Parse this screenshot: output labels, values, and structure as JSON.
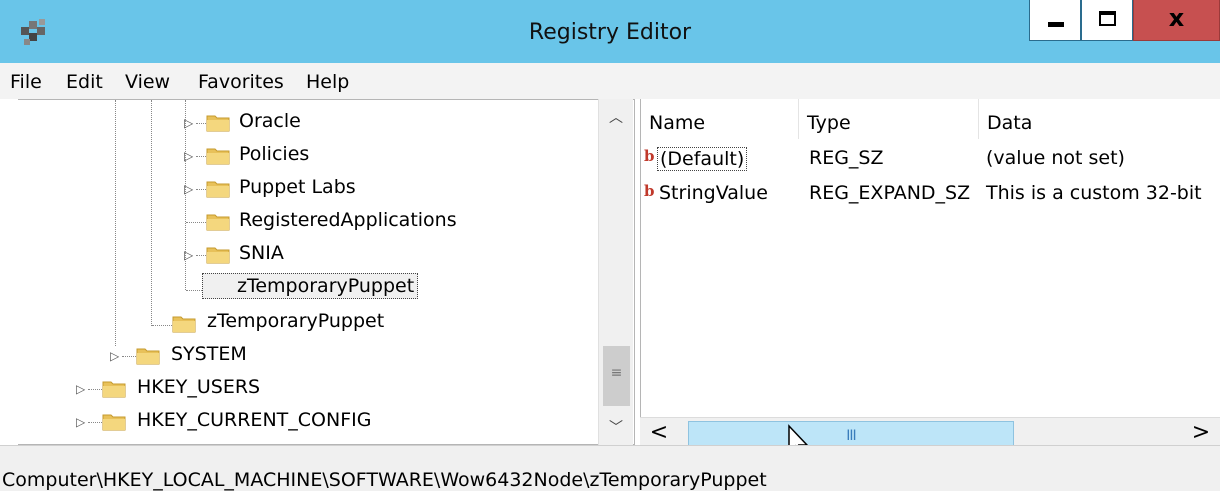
{
  "window": {
    "title": "Registry Editor",
    "close_symbol": "x",
    "app_icon": "registry-editor-icon"
  },
  "menu": [
    "File",
    "Edit",
    "View",
    "Favorites",
    "Help"
  ],
  "tree": {
    "items": [
      {
        "label": "Oracle",
        "expander": true
      },
      {
        "label": "Policies",
        "expander": true
      },
      {
        "label": "Puppet Labs",
        "expander": true
      },
      {
        "label": "RegisteredApplications",
        "expander": false
      },
      {
        "label": "SNIA",
        "expander": true
      },
      {
        "label": "zTemporaryPuppet",
        "expander": false,
        "selected": true
      },
      {
        "label": "zTemporaryPuppet",
        "expander": false
      },
      {
        "label": "SYSTEM",
        "expander": true
      },
      {
        "label": "HKEY_USERS",
        "expander": true
      },
      {
        "label": "HKEY_CURRENT_CONFIG",
        "expander": true
      }
    ]
  },
  "list": {
    "columns": [
      "Name",
      "Type",
      "Data"
    ],
    "rows": [
      {
        "name": "(Default)",
        "type": "REG_SZ",
        "data": "(value not set)"
      },
      {
        "name": "StringValue",
        "type": "REG_EXPAND_SZ",
        "data": "This is a custom 32-bit"
      }
    ]
  },
  "scrollbar": {
    "grip": "III",
    "left_arrow": "<",
    "right_arrow": ">"
  },
  "status": {
    "path": "Computer\\HKEY_LOCAL_MACHINE\\SOFTWARE\\Wow6432Node\\zTemporaryPuppet"
  },
  "colors": {
    "titlebar": "#69c5e9",
    "close_button": "#c75050",
    "scroll_thumb": "#bde5f8",
    "folder": "#e8c15a"
  }
}
